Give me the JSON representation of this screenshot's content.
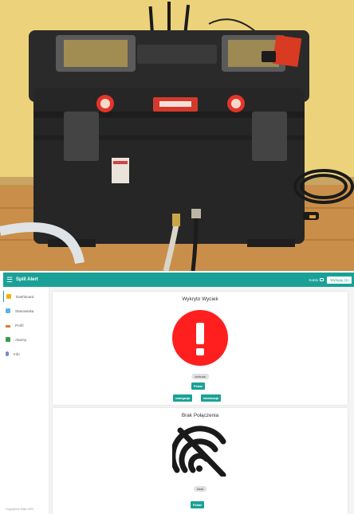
{
  "app": {
    "title": "Spill Alert",
    "menu_icon": "menu-icon",
    "account_label": "Konto",
    "logout_label": "Wyloguj (1)"
  },
  "sidebar": {
    "items": [
      {
        "label": "Dashboard",
        "icon": "dashboard-icon",
        "color": "#f0b400"
      },
      {
        "label": "Stanowiska",
        "icon": "stations-icon",
        "color": "#5ab4e6"
      },
      {
        "label": "Profil",
        "icon": "person-icon",
        "color": "#e07a3a"
      },
      {
        "label": "Alarmy",
        "icon": "alarm-icon",
        "color": "#3c9a4a"
      },
      {
        "label": "Info",
        "icon": "info-icon",
        "color": "#7a8ad0"
      }
    ],
    "footer": "Copyright by Daiku 2023"
  },
  "cards": [
    {
      "title": "Wykryto Wyciek",
      "status_icon": "alert-exclamation-icon",
      "status_color": "#ff1f1f",
      "chip": "centrala",
      "primary_button": "Pokaż",
      "secondary_buttons": [
        "nawigacja",
        "lokalizacja"
      ]
    },
    {
      "title": "Brak Połączenia",
      "status_icon": "no-signal-icon",
      "status_color": "#1a1a1a",
      "chip": "lokal",
      "primary_button": "Pokaż"
    }
  ],
  "colors": {
    "accent": "#1aa197"
  }
}
